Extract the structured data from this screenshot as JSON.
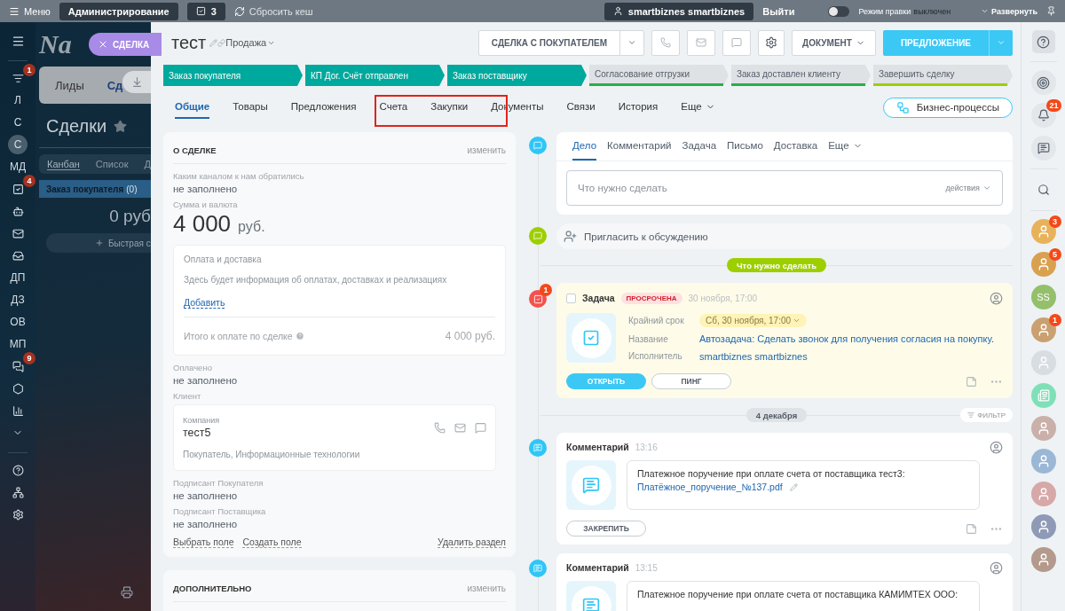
{
  "top_bar": {
    "menu": "Меню",
    "admin": "Администрирование",
    "counter": "3",
    "cache": "Сбросить кеш",
    "user": "smartbiznes smartbiznes",
    "logout": "Выйти",
    "edit_mode": {
      "label": "Режим правки",
      "state": "выключен",
      "on": false
    },
    "expand": "Развернуть"
  },
  "left_nav": {
    "items": [
      {
        "kind": "filter",
        "badge": "1",
        "selected": false
      },
      {
        "kind": "text",
        "label": "Л",
        "selected": false
      },
      {
        "kind": "text",
        "label": "С",
        "selected": false
      },
      {
        "kind": "text",
        "label": "С",
        "selected": true
      },
      {
        "kind": "text",
        "label": "МД",
        "selected": false
      },
      {
        "kind": "tasks",
        "badge": "4",
        "selected": false
      },
      {
        "kind": "robot",
        "selected": false
      },
      {
        "kind": "mail",
        "selected": false
      },
      {
        "kind": "inbox",
        "selected": false
      },
      {
        "kind": "text",
        "label": "ДП",
        "selected": false
      },
      {
        "kind": "text",
        "label": "ДЗ",
        "selected": false
      },
      {
        "kind": "text",
        "label": "ОВ",
        "selected": false
      },
      {
        "kind": "text",
        "label": "МП",
        "selected": false
      },
      {
        "kind": "chat",
        "badge": "9",
        "selected": false
      },
      {
        "kind": "hexagon",
        "selected": false
      },
      {
        "kind": "chart",
        "selected": false
      },
      {
        "kind": "more",
        "selected": false
      }
    ],
    "bottom": [
      {
        "kind": "help"
      },
      {
        "kind": "org"
      },
      {
        "kind": "settings"
      }
    ]
  },
  "background_page": {
    "logo": "Na",
    "tabs": [
      {
        "label": "Лиды",
        "selected": false
      },
      {
        "label": "Сд",
        "selected": true
      }
    ],
    "title": "Сделки",
    "views": [
      {
        "label": "Канбан",
        "selected": true
      },
      {
        "label": "Список",
        "selected": false
      },
      {
        "label": "Д",
        "selected": false
      }
    ],
    "column": {
      "title": "Заказ покупателя",
      "count": "(0)",
      "sum": "0 руб",
      "quick_add": "Быстрая с"
    }
  },
  "slider": {
    "tab": "СДЕЛКА"
  },
  "header": {
    "title": "тест",
    "category": "Продажа",
    "deal_type": "СДЕЛКА С ПОКУПАТЕЛЕМ",
    "document": "ДОКУМЕНТ",
    "offer": "ПРЕДЛОЖЕНИЕ"
  },
  "stages": [
    {
      "label": "Заказ покупателя",
      "done": true,
      "color": "#00a99d"
    },
    {
      "label": "КП Дог. Счёт отправлен",
      "done": true,
      "color": "#00a99d"
    },
    {
      "label": "Заказ поставщику",
      "done": true,
      "color": "#00a99d"
    },
    {
      "label": "Согласование отгрузки",
      "done": false,
      "color": "#29ad49"
    },
    {
      "label": "Заказ доставлен клиенту",
      "done": false,
      "color": "#29ad49"
    },
    {
      "label": "Завершить сделку",
      "done": false,
      "color": "#9dcf00"
    }
  ],
  "tabs": [
    {
      "label": "Общие",
      "selected": true
    },
    {
      "label": "Товары",
      "selected": false
    },
    {
      "label": "Предложения",
      "selected": false
    },
    {
      "label": "Счета",
      "selected": false
    },
    {
      "label": "Закупки",
      "selected": false
    },
    {
      "label": "Документы",
      "selected": false
    },
    {
      "label": "Связи",
      "selected": false
    },
    {
      "label": "История",
      "selected": false
    },
    {
      "label": "Еще",
      "selected": false,
      "menu": true
    }
  ],
  "business_processes": "Бизнес-процессы",
  "about": {
    "title": "О СДЕЛКЕ",
    "edit": "изменить",
    "channel": {
      "label": "Каким каналом к нам обратились",
      "value": "не заполнено"
    },
    "amount": {
      "label": "Сумма и валюта",
      "value": "4 000",
      "currency": "руб."
    },
    "payment": {
      "title": "Оплата и доставка",
      "info": "Здесь будет информация об оплатах, доставках и реализациях",
      "add": "Добавить",
      "total_label": "Итого к оплате по сделке",
      "total": "4 000 руб."
    },
    "paid": {
      "label": "Оплачено",
      "value": "не заполнено"
    },
    "client": {
      "label": "Клиент",
      "type": "Компания",
      "name": "тест5",
      "details": "Покупатель, Информационные технологии"
    },
    "signers": [
      {
        "label": "Подписант Покупателя",
        "value": "не заполнено"
      },
      {
        "label": "Подписант Поставщика",
        "value": "не заполнено"
      }
    ],
    "links": [
      "Выбрать поле",
      "Создать поле"
    ],
    "delete": "Удалить раздел"
  },
  "extra": {
    "title": "ДОПОЛНИТЕЛЬНО",
    "edit": "изменить"
  },
  "editor": {
    "tabs": [
      {
        "label": "Дело",
        "selected": true
      },
      {
        "label": "Комментарий",
        "selected": false
      },
      {
        "label": "Задача",
        "selected": false
      },
      {
        "label": "Письмо",
        "selected": false
      },
      {
        "label": "Доставка",
        "selected": false
      },
      {
        "label": "Еще",
        "selected": false,
        "menu": true
      }
    ],
    "placeholder": "Что нужно сделать",
    "actions": "действия"
  },
  "invite": "Пригласить к обсуждению",
  "todo_divider": "Что нужно сделать",
  "task": {
    "badge": "1",
    "checked": false,
    "title": "Задача",
    "status": "ПРОСРОЧЕНА",
    "time": "30 ноября, 17:00",
    "fields": [
      {
        "kind": "deadline",
        "label": "Крайний срок",
        "value": "Сб, 30 ноября, 17:00"
      },
      {
        "kind": "link",
        "label": "Название",
        "value": "Автозадача: Сделать звонок для получения согласия на покупку."
      },
      {
        "kind": "link",
        "label": "Исполнитель",
        "value": "smartbiznes smartbiznes"
      }
    ],
    "buttons": [
      {
        "label": "ОТКРЫТЬ",
        "primary": true
      },
      {
        "label": "ПИНГ",
        "primary": false
      }
    ]
  },
  "date_divider": "4 декабря",
  "filter": "ФИЛЬТР",
  "comments": [
    {
      "title": "Комментарий",
      "time": "13:16",
      "text": "Платежное поручение при оплате счета от поставщика тест3:",
      "file": "Платёжное_поручение_№137.pdf",
      "button": "ЗАКРЕПИТЬ"
    },
    {
      "title": "Комментарий",
      "time": "13:15",
      "text": "Платежное поручение при оплате счета от поставщика КАМИМТЕХ ООО:"
    }
  ],
  "right_bar": {
    "items": [
      {
        "kind": "help"
      },
      {
        "kind": "target"
      },
      {
        "kind": "bell",
        "badge": "21"
      },
      {
        "kind": "chat"
      },
      {
        "kind": "search"
      },
      {
        "kind": "avatar",
        "badge": "3"
      },
      {
        "kind": "avatar",
        "badge": "5"
      },
      {
        "kind": "initials",
        "label": "SS"
      },
      {
        "kind": "avatar",
        "badge": "1"
      },
      {
        "kind": "avatar"
      },
      {
        "kind": "news"
      },
      {
        "kind": "avatar"
      },
      {
        "kind": "avatar"
      },
      {
        "kind": "avatar"
      },
      {
        "kind": "avatar"
      },
      {
        "kind": "avatar"
      }
    ]
  }
}
